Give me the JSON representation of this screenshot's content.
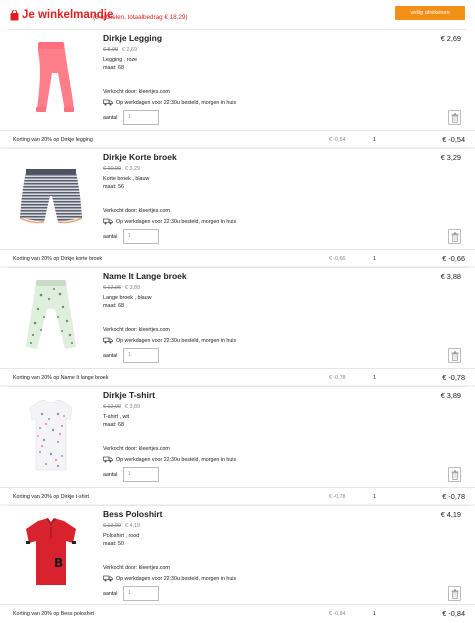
{
  "header": {
    "title": "Je winkelmandje",
    "subtitle": "(5 artikelen, totaalbedrag € 18,29)",
    "checkout_label": "veilig afrekenen",
    "accent": "#e02020",
    "button_color": "#f28f17"
  },
  "items": [
    {
      "name": "Dirkje Legging",
      "price": "€ 2,69",
      "old_price": "€ 8,99",
      "new_price": "€ 2,69",
      "desc1": "Legging , roze",
      "desc2": "maat: 68",
      "seller": "Verkocht door: kleertjes.com",
      "delivery": "Op werkdagen voor 22:30u besteld, morgen in huis",
      "qty_label": "aantal",
      "qty": "1",
      "discount_label": "Korting van 20% op Dirkje legging",
      "discount_amount": "€ -0,54",
      "discount_qty": "1",
      "discount_total": "€ -0,54",
      "image": "pink-legging"
    },
    {
      "name": "Dirkje Korte broek",
      "price": "€ 3,29",
      "old_price": "€ 10,99",
      "new_price": "€ 3,29",
      "desc1": "Korte broek , blauw",
      "desc2": "maat: 56",
      "seller": "Verkocht door: kleertjes.com",
      "delivery": "Op werkdagen voor 22:30u besteld, morgen in huis",
      "qty_label": "aantal",
      "qty": "1",
      "discount_label": "Korting van 20% op Dirkje korte broek",
      "discount_amount": "€ -0,66",
      "discount_qty": "1",
      "discount_total": "€ -0,66",
      "image": "striped-shorts"
    },
    {
      "name": "Name It Lange broek",
      "price": "€ 3,88",
      "old_price": "€ 12,95",
      "new_price": "€ 3,88",
      "desc1": "Lange broek , blauw",
      "desc2": "maat: 68",
      "seller": "Verkocht door: kleertjes.com",
      "delivery": "Op werkdagen voor 22:30u besteld, morgen in huis",
      "qty_label": "aantal",
      "qty": "1",
      "discount_label": "Korting van 20% op Name It lange broek",
      "discount_amount": "€ -0,78",
      "discount_qty": "1",
      "discount_total": "€ -0,78",
      "image": "printed-pants"
    },
    {
      "name": "Dirkje T-shirt",
      "price": "€ 3,89",
      "old_price": "€ 12,99",
      "new_price": "€ 3,89",
      "desc1": "T-shirt , wit",
      "desc2": "maat: 68",
      "seller": "Verkocht door: kleertjes.com",
      "delivery": "Op werkdagen voor 22:30u besteld, morgen in huis",
      "qty_label": "aantal",
      "qty": "1",
      "discount_label": "Korting van 20% op Dirkje t-shirt",
      "discount_amount": "€ -0,78",
      "discount_qty": "1",
      "discount_total": "€ -0,78",
      "image": "white-tshirt"
    },
    {
      "name": "Bess Poloshirt",
      "price": "€ 4,19",
      "old_price": "€ 13,99",
      "new_price": "€ 4,19",
      "desc1": "Poloshirt , rood",
      "desc2": "maat: 50",
      "seller": "Verkocht door: kleertjes.com",
      "delivery": "Op werkdagen voor 22:30u besteld, morgen in huis",
      "qty_label": "aantal",
      "qty": "1",
      "discount_label": "Korting van 20% op Bess poloshirt",
      "discount_amount": "€ -0,84",
      "discount_qty": "1",
      "discount_total": "€ -0,84",
      "image": "red-polo"
    }
  ]
}
